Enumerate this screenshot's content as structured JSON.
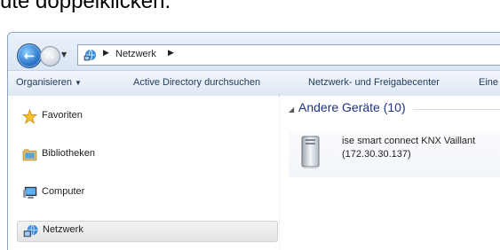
{
  "caption": {
    "text": "ute doppelklicken."
  },
  "navigation": {
    "back_icon": "back-arrow-icon",
    "forward_icon": "forward-arrow-icon",
    "history_dropdown_glyph": "▼"
  },
  "address_bar": {
    "icon": "network-icon",
    "separator_glyph": "▶",
    "location": "Netzwerk",
    "trailing_glyph": "▶"
  },
  "toolbar": {
    "items": [
      {
        "label": "Organisieren",
        "has_dropdown": true,
        "caret": "▼"
      },
      {
        "label": "Active Directory durchsuchen"
      },
      {
        "label": "Netzwerk- und Freigabecenter"
      },
      {
        "label": "Eine"
      }
    ]
  },
  "nav_pane": {
    "items": [
      {
        "label": "Favoriten",
        "icon": "star-icon"
      },
      {
        "label": "Bibliotheken",
        "icon": "library-icon"
      },
      {
        "label": "Computer",
        "icon": "computer-icon"
      },
      {
        "label": "Netzwerk",
        "icon": "network-icon",
        "selected": true
      }
    ]
  },
  "content": {
    "group": {
      "collapse_glyph": "◢",
      "title": "Andere Geräte (10)"
    },
    "devices": [
      {
        "name": "ise smart connect KNX Vaillant",
        "address": "(172.30.30.137)",
        "icon": "device-server-icon"
      }
    ]
  },
  "colors": {
    "group_title": "#1e3287",
    "toolbar_text": "#1e395b",
    "window_border": "#8fa3bd"
  }
}
